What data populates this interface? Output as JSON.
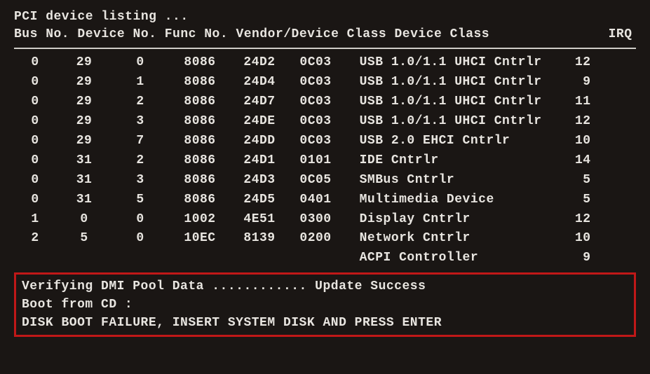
{
  "header": {
    "title": "PCI device listing ...",
    "columns": "Bus No. Device No. Func No. Vendor/Device Class Device Class               IRQ"
  },
  "devices": [
    {
      "bus": "0",
      "device": "29",
      "func": "0",
      "vendor": "8086",
      "class": "24D2",
      "class2": "0C03",
      "name": "USB 1.0/1.1 UHCI Cntrlr",
      "irq": "12"
    },
    {
      "bus": "0",
      "device": "29",
      "func": "1",
      "vendor": "8086",
      "class": "24D4",
      "class2": "0C03",
      "name": "USB 1.0/1.1 UHCI Cntrlr",
      "irq": "9"
    },
    {
      "bus": "0",
      "device": "29",
      "func": "2",
      "vendor": "8086",
      "class": "24D7",
      "class2": "0C03",
      "name": "USB 1.0/1.1 UHCI Cntrlr",
      "irq": "11"
    },
    {
      "bus": "0",
      "device": "29",
      "func": "3",
      "vendor": "8086",
      "class": "24DE",
      "class2": "0C03",
      "name": "USB 1.0/1.1 UHCI Cntrlr",
      "irq": "12"
    },
    {
      "bus": "0",
      "device": "29",
      "func": "7",
      "vendor": "8086",
      "class": "24DD",
      "class2": "0C03",
      "name": "USB 2.0 EHCI Cntrlr",
      "irq": "10"
    },
    {
      "bus": "0",
      "device": "31",
      "func": "2",
      "vendor": "8086",
      "class": "24D1",
      "class2": "0101",
      "name": "IDE Cntrlr",
      "irq": "14"
    },
    {
      "bus": "0",
      "device": "31",
      "func": "3",
      "vendor": "8086",
      "class": "24D3",
      "class2": "0C05",
      "name": "SMBus Cntrlr",
      "irq": "5"
    },
    {
      "bus": "0",
      "device": "31",
      "func": "5",
      "vendor": "8086",
      "class": "24D5",
      "class2": "0401",
      "name": "Multimedia Device",
      "irq": "5"
    },
    {
      "bus": "1",
      "device": "0",
      "func": "0",
      "vendor": "1002",
      "class": "4E51",
      "class2": "0300",
      "name": "Display Cntrlr",
      "irq": "12"
    },
    {
      "bus": "2",
      "device": "5",
      "func": "0",
      "vendor": "10EC",
      "class": "8139",
      "class2": "0200",
      "name": "Network Cntrlr",
      "irq": "10"
    },
    {
      "bus": "",
      "device": "",
      "func": "",
      "vendor": "",
      "class": "",
      "class2": "",
      "name": "ACPI Controller",
      "irq": "9"
    }
  ],
  "status": {
    "dmi": "Verifying DMI Pool Data ............ Update Success",
    "boot": "Boot from CD :",
    "error": "DISK BOOT FAILURE, INSERT SYSTEM DISK AND PRESS ENTER"
  }
}
